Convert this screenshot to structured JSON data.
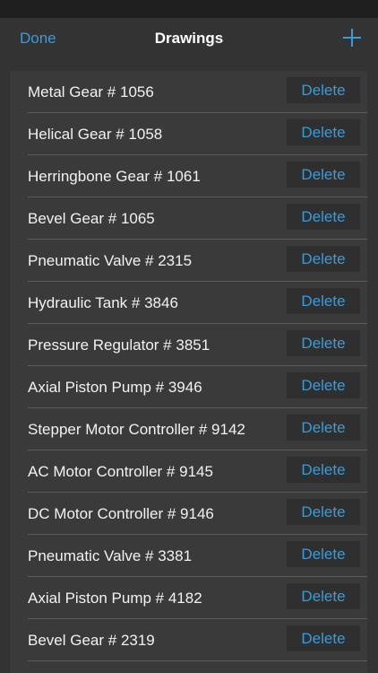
{
  "nav": {
    "done_label": "Done",
    "title": "Drawings",
    "add_icon": "plus-icon"
  },
  "colors": {
    "accent": "#3a9bd9",
    "background": "#333333",
    "list_background": "#3a3a3a",
    "text": "#f2f2f2"
  },
  "drawings": [
    {
      "name": "Metal Gear # 1056",
      "action": "Delete"
    },
    {
      "name": "Helical Gear # 1058",
      "action": "Delete"
    },
    {
      "name": "Herringbone Gear # 1061",
      "action": "Delete"
    },
    {
      "name": "Bevel Gear # 1065",
      "action": "Delete"
    },
    {
      "name": "Pneumatic Valve # 2315",
      "action": "Delete"
    },
    {
      "name": "Hydraulic Tank # 3846",
      "action": "Delete"
    },
    {
      "name": "Pressure Regulator # 3851",
      "action": "Delete"
    },
    {
      "name": "Axial Piston Pump # 3946",
      "action": "Delete"
    },
    {
      "name": "Stepper Motor Controller # 9142",
      "action": "Delete"
    },
    {
      "name": "AC Motor Controller # 9145",
      "action": "Delete"
    },
    {
      "name": "DC Motor Controller # 9146",
      "action": "Delete"
    },
    {
      "name": "Pneumatic Valve # 3381",
      "action": "Delete"
    },
    {
      "name": "Axial Piston Pump # 4182",
      "action": "Delete"
    },
    {
      "name": "Bevel Gear # 2319",
      "action": "Delete"
    }
  ]
}
